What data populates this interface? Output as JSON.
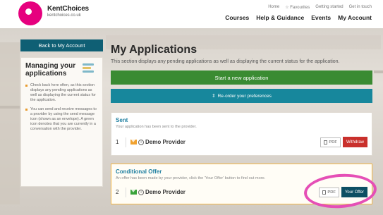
{
  "header": {
    "logo_title": "KentChoices",
    "logo_subtitle": "kentchoices.co.uk",
    "util_links": [
      "Home",
      "☆ Favourites",
      "Getting started",
      "Get in touch"
    ],
    "nav": [
      "Courses",
      "Help & Guidance",
      "Events",
      "My Account"
    ]
  },
  "sidebar": {
    "back_label": "Back to My Account",
    "title": "Managing your applications",
    "bullets": [
      "Check back here often, as this section displays any pending applications as well as displaying the current status for the application.",
      "You can send and receive messages to a provider by using the send message icon (shown as an envelope). A green icon denotes that you are currently in a conversation with the provider."
    ]
  },
  "main": {
    "title": "My Applications",
    "intro": "This section displays any pending applications as well as displaying the current status for the application.",
    "new_application_label": "Start a new application",
    "reorder_label": "Re-order your preferences",
    "reorder_icon": "sort-icon"
  },
  "cards": {
    "sent": {
      "title": "Sent",
      "subtitle": "Your application has been sent to the provider.",
      "number": "1",
      "provider": "Demo Provider",
      "pdf_label": "PDF",
      "action_label": "Withdraw"
    },
    "offer": {
      "title": "Conditional Offer",
      "subtitle": "An offer has been made by your provider, click the 'Your Offer' button to find out more.",
      "number": "2",
      "provider": "Demo Provider",
      "pdf_label": "PDF",
      "action_label": "Your Offer"
    }
  },
  "colors": {
    "brand": "#e6007e",
    "primary_teal": "#0f5f74",
    "success_green": "#3a8b32",
    "withdraw_red": "#c9302c",
    "offer_border": "#f2b544",
    "annotation": "#e54fb6"
  }
}
